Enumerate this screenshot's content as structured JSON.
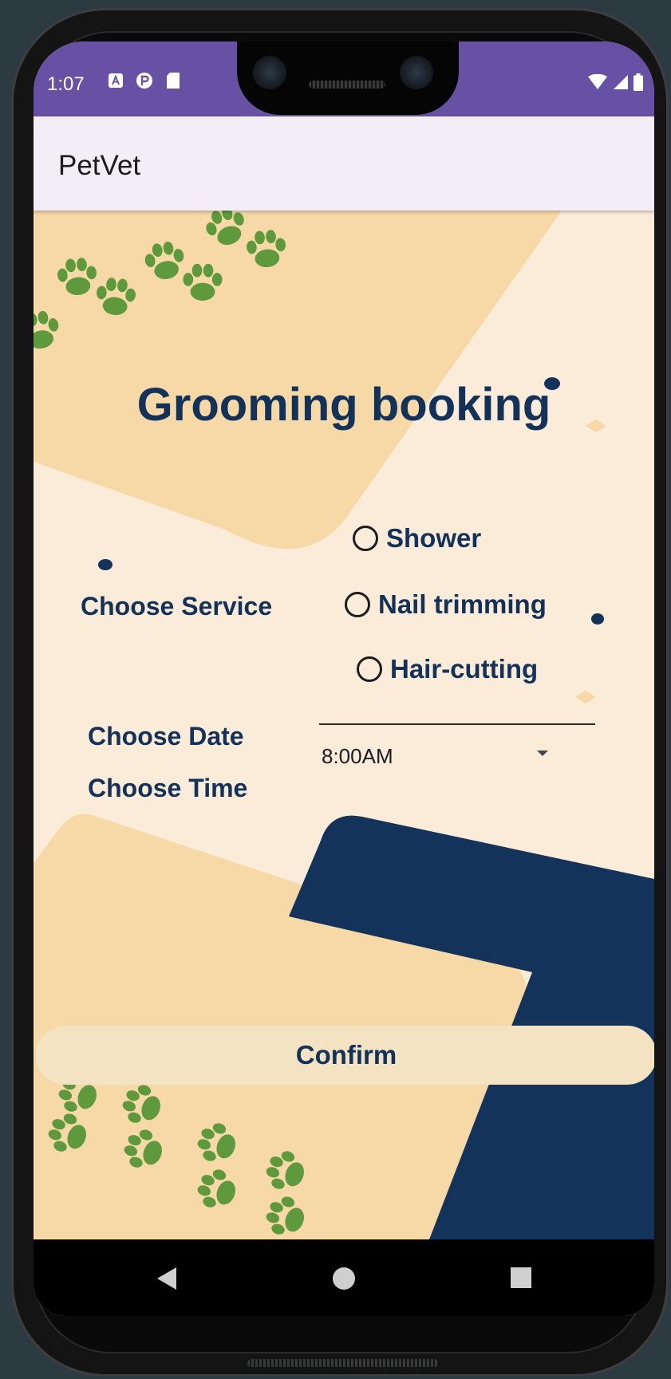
{
  "status_bar": {
    "time": "1:07",
    "left_icons": [
      "a-icon",
      "p-icon",
      "sd-card-icon"
    ],
    "right_icons": [
      "wifi-icon",
      "signal-icon",
      "battery-icon"
    ]
  },
  "app_bar": {
    "title": "PetVet"
  },
  "form": {
    "heading": "Grooming booking",
    "service_label": "Choose Service",
    "services": [
      {
        "label": "Shower",
        "selected": false
      },
      {
        "label": "Nail trimming",
        "selected": false
      },
      {
        "label": "Hair-cutting",
        "selected": false
      }
    ],
    "date_label": "Choose Date",
    "date_value": "",
    "time_label": "Choose Time",
    "time_value": "8:00AM"
  },
  "confirm_label": "Confirm",
  "nav": {
    "icons": [
      "back-icon",
      "home-icon",
      "recents-icon"
    ]
  },
  "colors": {
    "status_bar": "#6651a5",
    "app_bar": "#f3edf7",
    "primary_text": "#12325a",
    "background": "#fbecd9",
    "accent_shape": "#f6d9a6",
    "dark_shape": "#13335a",
    "paw": "#5e9a3d",
    "button": "#f3e3c3"
  }
}
